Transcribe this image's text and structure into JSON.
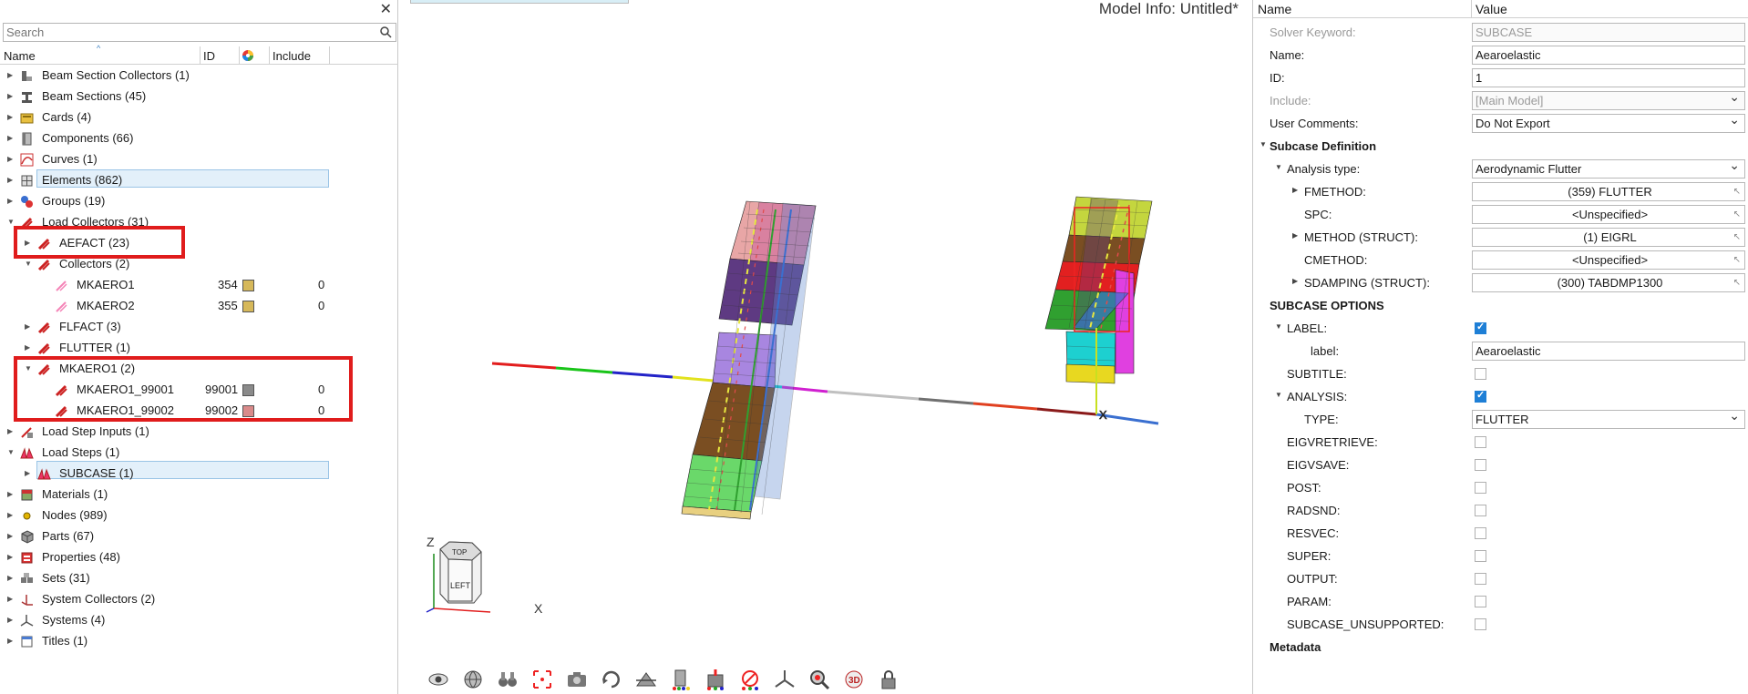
{
  "left_panel": {
    "search_placeholder": "Search",
    "columns": {
      "name": "Name",
      "id": "ID",
      "include": "Include"
    },
    "tree": [
      {
        "label": "Beam Section Collectors  (1)",
        "icon": "beam-section-collector-icon"
      },
      {
        "label": "Beam Sections  (45)",
        "icon": "beam-section-icon"
      },
      {
        "label": "Cards  (4)",
        "icon": "cards-icon"
      },
      {
        "label": "Components  (66)",
        "icon": "components-icon"
      },
      {
        "label": "Curves  (1)",
        "icon": "curves-icon"
      },
      {
        "label": "Elements  (862)",
        "icon": "elements-icon"
      },
      {
        "label": "Groups  (19)",
        "icon": "groups-icon"
      },
      {
        "label": "Load Collectors  (31)",
        "icon": "load-collector-icon"
      },
      {
        "label": "AEFACT  (23)",
        "icon": "load-collector-icon"
      },
      {
        "label": "Collectors  (2)",
        "icon": "load-collector-icon"
      },
      {
        "label": "MKAERO1",
        "icon": "load-collector-icon",
        "id": "354",
        "color": "#d6b85a",
        "include": "0"
      },
      {
        "label": "MKAERO2",
        "icon": "load-collector-icon",
        "id": "355",
        "color": "#d6b85a",
        "include": "0"
      },
      {
        "label": "FLFACT  (3)",
        "icon": "load-collector-icon"
      },
      {
        "label": "FLUTTER  (1)",
        "icon": "load-collector-icon"
      },
      {
        "label": "MKAERO1  (2)",
        "icon": "load-collector-icon"
      },
      {
        "label": "MKAERO1_99001",
        "icon": "load-collector-icon",
        "id": "99001",
        "color": "#8a8a8a",
        "include": "0"
      },
      {
        "label": "MKAERO1_99002",
        "icon": "load-collector-icon",
        "id": "99002",
        "color": "#d98a8a",
        "include": "0"
      },
      {
        "label": "Load Step Inputs  (1)",
        "icon": "load-step-input-icon"
      },
      {
        "label": "Load Steps  (1)",
        "icon": "load-steps-icon"
      },
      {
        "label": "SUBCASE  (1)",
        "icon": "load-steps-icon"
      },
      {
        "label": "Materials  (1)",
        "icon": "materials-icon"
      },
      {
        "label": "Nodes  (989)",
        "icon": "nodes-icon"
      },
      {
        "label": "Parts  (67)",
        "icon": "parts-icon"
      },
      {
        "label": "Properties  (48)",
        "icon": "properties-icon"
      },
      {
        "label": "Sets  (31)",
        "icon": "sets-icon"
      },
      {
        "label": "System Collectors  (2)",
        "icon": "system-collectors-icon"
      },
      {
        "label": "Systems  (4)",
        "icon": "systems-icon"
      },
      {
        "label": "Titles  (1)",
        "icon": "titles-icon"
      }
    ]
  },
  "viewport": {
    "model_info": "Model Info: Untitled*",
    "triad": {
      "z": "Z",
      "x": "X",
      "cube_top": "TOP",
      "cube_front": "LEFT"
    },
    "axis_x_label": "X"
  },
  "right_panel": {
    "columns": {
      "name": "Name",
      "value": "Value"
    },
    "rows": [
      {
        "label": "Solver Keyword:",
        "value": "SUBCASE"
      },
      {
        "label": "Name:",
        "value": "Aearoelastic"
      },
      {
        "label": "ID:",
        "value": "1"
      },
      {
        "label": "Include:",
        "value": "[Main Model]"
      },
      {
        "label": "User Comments:",
        "value": "Do Not Export"
      },
      {
        "label": "Subcase Definition"
      },
      {
        "label": "Analysis type:",
        "value": "Aerodynamic Flutter"
      },
      {
        "label": "FMETHOD:",
        "value": "(359) FLUTTER"
      },
      {
        "label": "SPC:",
        "value": "<Unspecified>"
      },
      {
        "label": "METHOD (STRUCT):",
        "value": "(1) EIGRL"
      },
      {
        "label": "CMETHOD:",
        "value": "<Unspecified>"
      },
      {
        "label": "SDAMPING (STRUCT):",
        "value": "(300) TABDMP1300"
      },
      {
        "label": "SUBCASE OPTIONS"
      },
      {
        "label": "LABEL:",
        "checked": true
      },
      {
        "label": "label:",
        "value": "Aearoelastic"
      },
      {
        "label": "SUBTITLE:",
        "checked": false
      },
      {
        "label": "ANALYSIS:",
        "checked": true
      },
      {
        "label": "TYPE:",
        "value": "FLUTTER"
      },
      {
        "label": "EIGVRETRIEVE:",
        "checked": false
      },
      {
        "label": "EIGVSAVE:",
        "checked": false
      },
      {
        "label": "POST:",
        "checked": false
      },
      {
        "label": "RADSND:",
        "checked": false
      },
      {
        "label": "RESVEC:",
        "checked": false
      },
      {
        "label": "SUPER:",
        "checked": false
      },
      {
        "label": "OUTPUT:",
        "checked": false
      },
      {
        "label": "PARAM:",
        "checked": false
      },
      {
        "label": "SUBCASE_UNSUPPORTED:",
        "checked": false
      },
      {
        "label": "Metadata"
      }
    ]
  }
}
